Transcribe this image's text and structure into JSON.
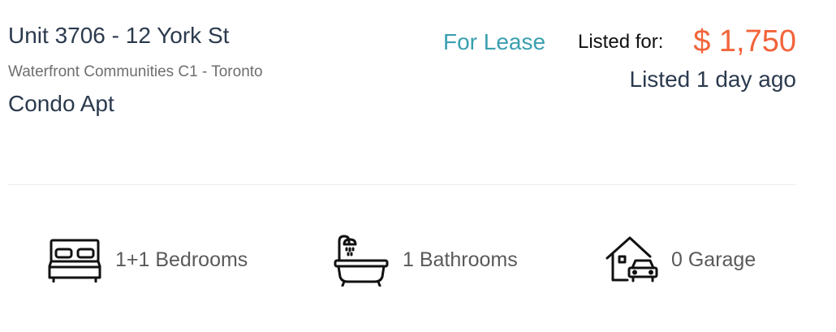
{
  "listing": {
    "address": "Unit 3706 - 12 York St",
    "area": "Waterfront Communities C1 - Toronto",
    "type": "Condo Apt",
    "status": "For Lease",
    "listed_for_label": "Listed for:",
    "price": "$ 1,750",
    "listed_ago": "Listed 1 day ago"
  },
  "features": {
    "bedrooms": {
      "icon": "bed-icon",
      "label": "1+1 Bedrooms"
    },
    "bathrooms": {
      "icon": "bathtub-icon",
      "label": "1 Bathrooms"
    },
    "garage": {
      "icon": "garage-icon",
      "label": "0 Garage"
    }
  },
  "colors": {
    "heading": "#2b3a4e",
    "status": "#3a9fb0",
    "price": "#f2643a",
    "muted": "#6e6e6e"
  }
}
